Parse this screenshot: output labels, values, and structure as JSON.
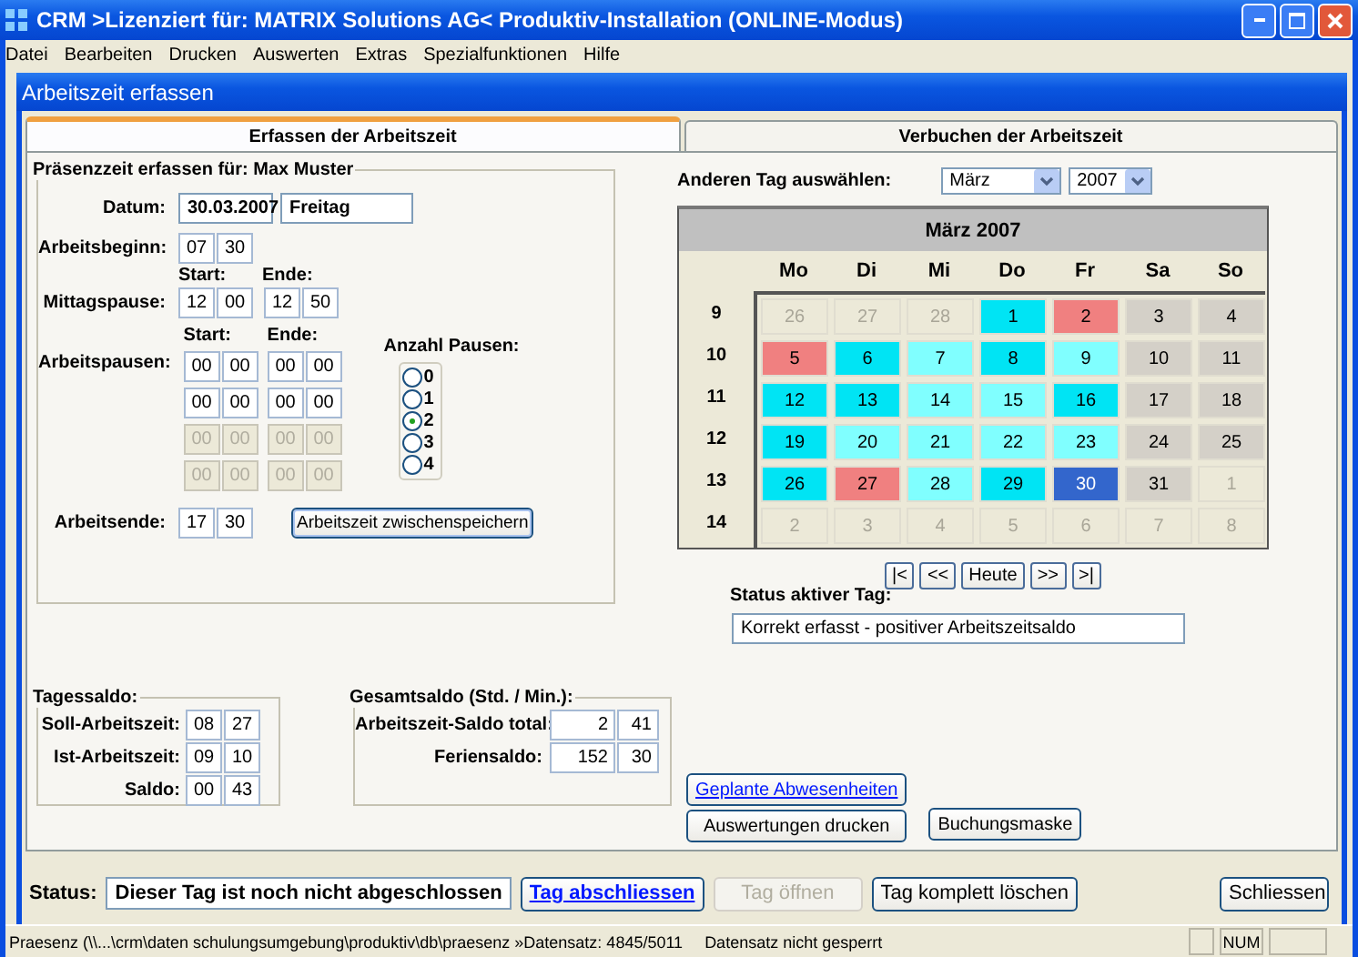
{
  "window": {
    "title": "CRM >Lizenziert für: MATRIX Solutions AG< Produktiv-Installation (ONLINE-Modus)"
  },
  "menu": [
    "Datei",
    "Bearbeiten",
    "Drucken",
    "Auswerten",
    "Extras",
    "Spezialfunktionen",
    "Hilfe"
  ],
  "form": {
    "title": "Arbeitszeit erfassen",
    "tabs": [
      {
        "label": "Erfassen der Arbeitszeit",
        "selected": true
      },
      {
        "label": "Verbuchen der Arbeitszeit",
        "selected": false
      }
    ],
    "presence": {
      "legend": "Präsenzzeit erfassen für: Max Muster",
      "date_label": "Datum:",
      "date": "30.03.2007",
      "weekday": "Freitag",
      "start_label": "Arbeitsbeginn:",
      "start": [
        "07",
        "30"
      ],
      "lunch_label": "Mittagspause:",
      "lunch_start_label": "Start:",
      "lunch_end_label": "Ende:",
      "lunch_start": [
        "12",
        "00"
      ],
      "lunch_end": [
        "12",
        "50"
      ],
      "breaks_label": "Arbeitspausen:",
      "breaks_start_label": "Start:",
      "breaks_end_label": "Ende:",
      "breaks": [
        {
          "start": [
            "00",
            "00"
          ],
          "end": [
            "00",
            "00"
          ],
          "disabled": false
        },
        {
          "start": [
            "00",
            "00"
          ],
          "end": [
            "00",
            "00"
          ],
          "disabled": false
        },
        {
          "start": [
            "00",
            "00"
          ],
          "end": [
            "00",
            "00"
          ],
          "disabled": true
        },
        {
          "start": [
            "00",
            "00"
          ],
          "end": [
            "00",
            "00"
          ],
          "disabled": true
        }
      ],
      "break_count_label": "Anzahl Pausen:",
      "break_count_options": [
        {
          "label": "0",
          "selected": false
        },
        {
          "label": "1",
          "selected": false
        },
        {
          "label": "2",
          "selected": true
        },
        {
          "label": "3",
          "selected": false
        },
        {
          "label": "4",
          "selected": false
        }
      ],
      "end_label": "Arbeitsende:",
      "end": [
        "17",
        "30"
      ],
      "save_button": "Arbeitszeit zwischenspeichern"
    },
    "day_balance": {
      "legend": "Tagessaldo:",
      "rows": [
        {
          "label": "Soll-Arbeitszeit:",
          "values": [
            "08",
            "27"
          ]
        },
        {
          "label": "Ist-Arbeitszeit:",
          "values": [
            "09",
            "10"
          ]
        },
        {
          "label": "Saldo:",
          "values": [
            "00",
            "43"
          ]
        }
      ]
    },
    "total_balance": {
      "legend": "Gesamtsaldo (Std. / Min.):",
      "rows": [
        {
          "label": "Arbeitszeit-Saldo total:",
          "values": [
            "2",
            "41"
          ]
        },
        {
          "label": "Feriensaldo:",
          "values": [
            "152",
            "30"
          ]
        }
      ]
    },
    "calendar": {
      "pick_label": "Anderen Tag auswählen:",
      "month": "März",
      "year": "2007",
      "title": "März 2007",
      "weekdays": [
        "Mo",
        "Di",
        "Mi",
        "Do",
        "Fr",
        "Sa",
        "So"
      ],
      "weeks": [
        {
          "week": "9",
          "days": [
            {
              "day": "26",
              "color": "#ece9d8",
              "outside": true,
              "selected": false
            },
            {
              "day": "27",
              "color": "#ece9d8",
              "outside": true,
              "selected": false
            },
            {
              "day": "28",
              "color": "#ece9d8",
              "outside": true,
              "selected": false
            },
            {
              "day": "1",
              "color": "#00e4f4",
              "outside": false,
              "selected": false
            },
            {
              "day": "2",
              "color": "#f08080",
              "outside": false,
              "selected": false
            },
            {
              "day": "3",
              "color": "#d4d0c8",
              "outside": false,
              "selected": false
            },
            {
              "day": "4",
              "color": "#d4d0c8",
              "outside": false,
              "selected": false
            }
          ]
        },
        {
          "week": "10",
          "days": [
            {
              "day": "5",
              "color": "#f08080",
              "outside": false,
              "selected": false
            },
            {
              "day": "6",
              "color": "#00e4f4",
              "outside": false,
              "selected": false
            },
            {
              "day": "7",
              "color": "#80ffff",
              "outside": false,
              "selected": false
            },
            {
              "day": "8",
              "color": "#00e4f4",
              "outside": false,
              "selected": false
            },
            {
              "day": "9",
              "color": "#80ffff",
              "outside": false,
              "selected": false
            },
            {
              "day": "10",
              "color": "#d4d0c8",
              "outside": false,
              "selected": false
            },
            {
              "day": "11",
              "color": "#d4d0c8",
              "outside": false,
              "selected": false
            }
          ]
        },
        {
          "week": "11",
          "days": [
            {
              "day": "12",
              "color": "#00e4f4",
              "outside": false,
              "selected": false
            },
            {
              "day": "13",
              "color": "#00e4f4",
              "outside": false,
              "selected": false
            },
            {
              "day": "14",
              "color": "#80ffff",
              "outside": false,
              "selected": false
            },
            {
              "day": "15",
              "color": "#80ffff",
              "outside": false,
              "selected": false
            },
            {
              "day": "16",
              "color": "#00e4f4",
              "outside": false,
              "selected": false
            },
            {
              "day": "17",
              "color": "#d4d0c8",
              "outside": false,
              "selected": false
            },
            {
              "day": "18",
              "color": "#d4d0c8",
              "outside": false,
              "selected": false
            }
          ]
        },
        {
          "week": "12",
          "days": [
            {
              "day": "19",
              "color": "#00e4f4",
              "outside": false,
              "selected": false
            },
            {
              "day": "20",
              "color": "#80ffff",
              "outside": false,
              "selected": false
            },
            {
              "day": "21",
              "color": "#80ffff",
              "outside": false,
              "selected": false
            },
            {
              "day": "22",
              "color": "#80ffff",
              "outside": false,
              "selected": false
            },
            {
              "day": "23",
              "color": "#80ffff",
              "outside": false,
              "selected": false
            },
            {
              "day": "24",
              "color": "#d4d0c8",
              "outside": false,
              "selected": false
            },
            {
              "day": "25",
              "color": "#d4d0c8",
              "outside": false,
              "selected": false
            }
          ]
        },
        {
          "week": "13",
          "days": [
            {
              "day": "26",
              "color": "#00e4f4",
              "outside": false,
              "selected": false
            },
            {
              "day": "27",
              "color": "#f08080",
              "outside": false,
              "selected": false
            },
            {
              "day": "28",
              "color": "#80ffff",
              "outside": false,
              "selected": false
            },
            {
              "day": "29",
              "color": "#00e4f4",
              "outside": false,
              "selected": false
            },
            {
              "day": "30",
              "color": "#3366cc",
              "outside": false,
              "selected": true
            },
            {
              "day": "31",
              "color": "#d4d0c8",
              "outside": false,
              "selected": false
            },
            {
              "day": "1",
              "color": "#ece9d8",
              "outside": true,
              "selected": false
            }
          ]
        },
        {
          "week": "14",
          "days": [
            {
              "day": "2",
              "color": "#ece9d8",
              "outside": true,
              "selected": false
            },
            {
              "day": "3",
              "color": "#ece9d8",
              "outside": true,
              "selected": false
            },
            {
              "day": "4",
              "color": "#ece9d8",
              "outside": true,
              "selected": false
            },
            {
              "day": "5",
              "color": "#ece9d8",
              "outside": true,
              "selected": false
            },
            {
              "day": "6",
              "color": "#ece9d8",
              "outside": true,
              "selected": false
            },
            {
              "day": "7",
              "color": "#ece9d8",
              "outside": true,
              "selected": false
            },
            {
              "day": "8",
              "color": "#ece9d8",
              "outside": true,
              "selected": false
            }
          ]
        }
      ],
      "nav": [
        "|<",
        "<<",
        "Heute",
        ">>",
        ">|"
      ]
    },
    "day_status": {
      "label": "Status aktiver Tag:",
      "value": "Korrekt erfasst - positiver Arbeitszeitsaldo"
    },
    "actions": [
      {
        "label": "Geplante Abwesenheiten",
        "kind": "link"
      },
      {
        "label": "Auswertungen drucken",
        "kind": "button"
      },
      {
        "label": "Buchungsmaske",
        "kind": "button"
      }
    ],
    "status_label": "Status:",
    "status": "Dieser Tag ist noch nicht abgeschlossen",
    "buttons": [
      {
        "label": "Tag abschliessen",
        "kind": "link",
        "disabled": false
      },
      {
        "label": "Tag öffnen",
        "kind": "button",
        "disabled": true
      },
      {
        "label": "Tag komplett löschen",
        "kind": "button",
        "disabled": false
      }
    ],
    "close_button": "Schliessen"
  },
  "status_bar": {
    "path": "Praesenz (\\\\...\\crm\\daten schulungsumgebung\\produktiv\\db\\praesenz »Datensatz: 4845/5011",
    "lock": "Datensatz nicht gesperrt",
    "num": "NUM"
  }
}
